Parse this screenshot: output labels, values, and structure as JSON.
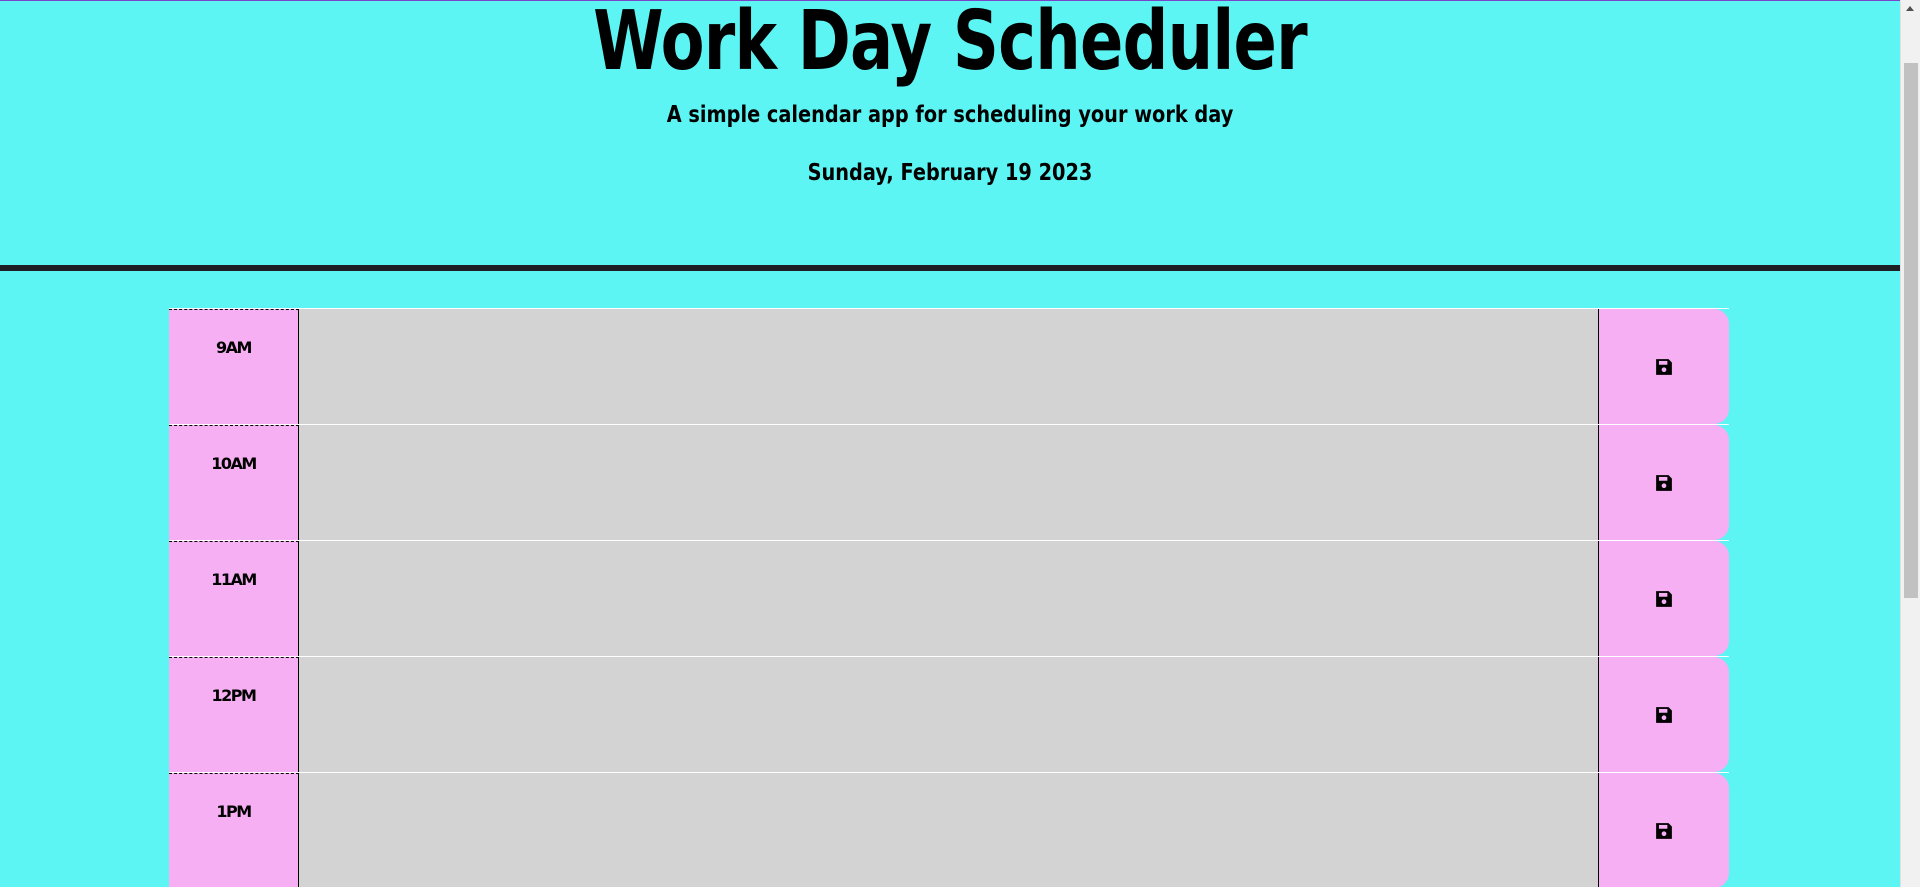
{
  "header": {
    "title": "Work Day Scheduler",
    "subtitle": "A simple calendar app for scheduling your work day",
    "current_day": "Sunday, February 19 2023"
  },
  "time_blocks": [
    {
      "hour": "9AM",
      "text": ""
    },
    {
      "hour": "10AM",
      "text": ""
    },
    {
      "hour": "11AM",
      "text": ""
    },
    {
      "hour": "12PM",
      "text": ""
    },
    {
      "hour": "1PM",
      "text": ""
    }
  ],
  "icons": {
    "save": "floppy-disk-icon"
  },
  "colors": {
    "page_background": "#5df4f4",
    "hour_background": "#f6aff2",
    "textarea_background": "#d3d3d3",
    "divider": "#1c1f24"
  }
}
